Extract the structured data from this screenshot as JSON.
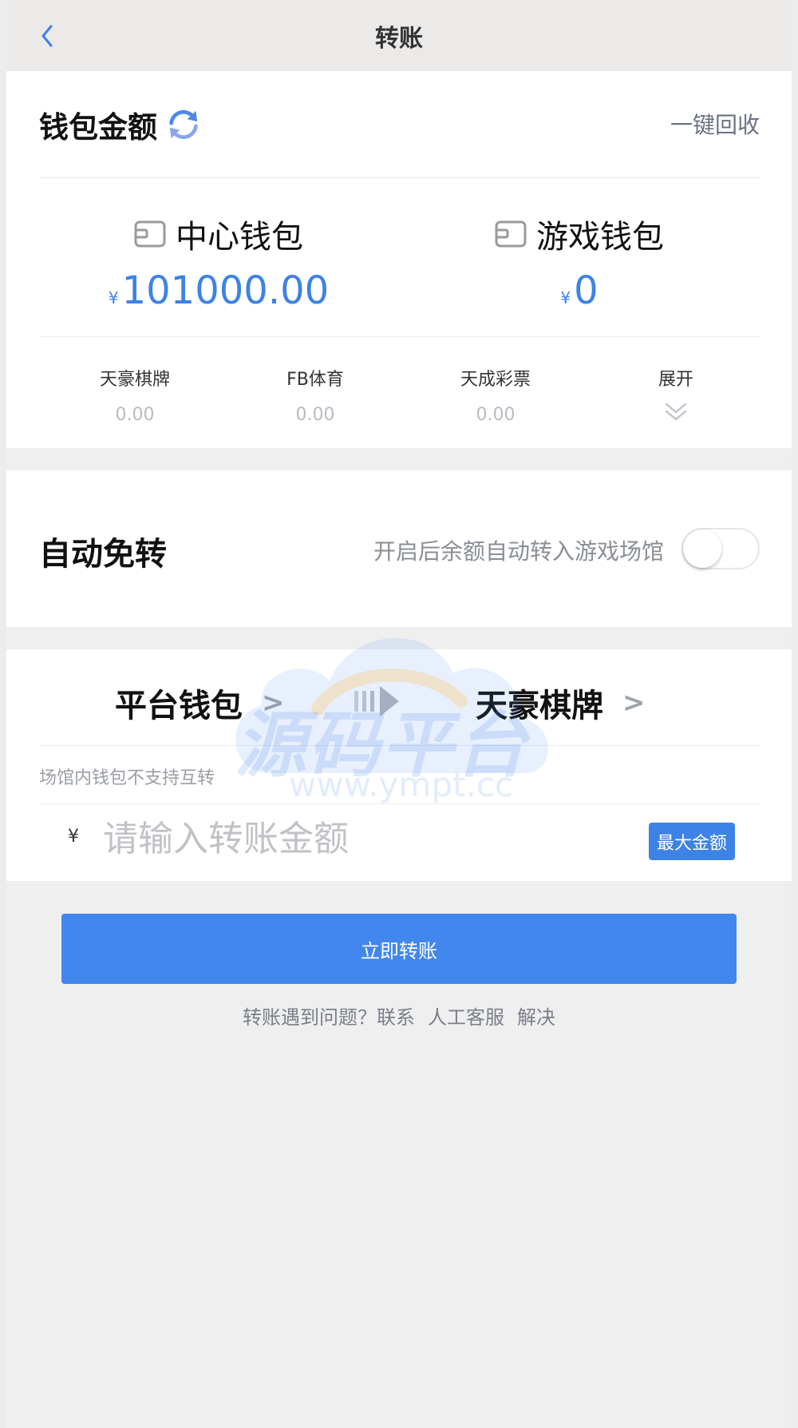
{
  "header": {
    "title": "转账"
  },
  "wallet": {
    "title": "钱包金额",
    "recycle_label": "一键回收",
    "center": {
      "name": "中心钱包",
      "currency": "¥",
      "amount": "101000.00"
    },
    "game": {
      "name": "游戏钱包",
      "currency": "¥",
      "amount": "0"
    },
    "venues": [
      {
        "name": "天豪棋牌",
        "balance": "0.00"
      },
      {
        "name": "FB体育",
        "balance": "0.00"
      },
      {
        "name": "天成彩票",
        "balance": "0.00"
      }
    ],
    "expand_label": "展开"
  },
  "auto_transfer": {
    "title": "自动免转",
    "hint": "开启后余额自动转入游戏场馆",
    "enabled": false
  },
  "transfer": {
    "from": "平台钱包",
    "to": "天豪棋牌",
    "arrow": ">",
    "note": "场馆内钱包不支持互转",
    "currency": "¥",
    "placeholder": "请输入转账金额",
    "max_label": "最大金额"
  },
  "submit_label": "立即转账",
  "help": {
    "prefix": "转账遇到问题？联系",
    "link": "人工客服",
    "suffix": "解决"
  },
  "watermark": {
    "text": "源码平台",
    "url": "www.ympt.cc"
  },
  "colors": {
    "accent": "#3d82e6",
    "button": "#4287ed",
    "background": "#efeff0"
  }
}
